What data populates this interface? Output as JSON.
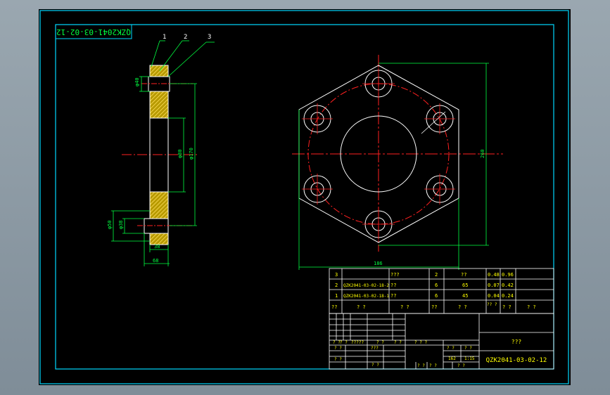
{
  "drawing": {
    "number_mirrored": "QZK2041-03-02-12",
    "number": "QZK2041-03-02-12",
    "part_name": "???"
  },
  "colors": {
    "border": "#00d8ff",
    "outline": "#ffffff",
    "centerline": "#ff2020",
    "dimension": "#00ff40",
    "hatch": "#e0c000",
    "text_yellow": "#ffff00"
  },
  "balloons": [
    "1",
    "2",
    "3"
  ],
  "dimensions": {
    "side_top_bore": "φ40",
    "side_inner": "φ80",
    "side_outer": "φ170",
    "side_bottom_a": "φ50",
    "side_bottom_b": "φ38",
    "side_flange_w": "38",
    "side_total_w": "68",
    "front_height": "260",
    "front_width": "186"
  },
  "bom": [
    {
      "no": "3",
      "code": "",
      "name": "???",
      "qty": "2",
      "material": "??",
      "unit": "0.48",
      "total": "0.96"
    },
    {
      "no": "2",
      "code": "QZK2041-03-02-18-2",
      "name": "??",
      "qty": "6",
      "material": "65",
      "unit": "0.07",
      "total": "0.42"
    },
    {
      "no": "1",
      "code": "QZK2041-03-02-18-1",
      "name": "??",
      "qty": "6",
      "material": "45",
      "unit": "0.04",
      "total": "0.24"
    }
  ],
  "bom_header": {
    "no": "??",
    "code": "?  ?",
    "name": "?  ?",
    "qty": "??",
    "material": "?  ?",
    "unit": "??  ?",
    "total": "?  ?",
    "note": "?  ?"
  },
  "title_block": {
    "row_a": [
      "?  ?",
      "?  ?",
      "?????",
      "?  ?",
      "?  ?"
    ],
    "scale_hdr": "? ? ?",
    "weight_hdr": "?  ?",
    "ratio_hdr": "?  ?",
    "weight": "162",
    "scale": "1:15",
    "designer": "?  ?",
    "std": "???",
    "checker": "?  ?",
    "approver": "?  ?",
    "sheets": [
      "?  ?",
      "?  ?",
      "?  ?"
    ]
  }
}
